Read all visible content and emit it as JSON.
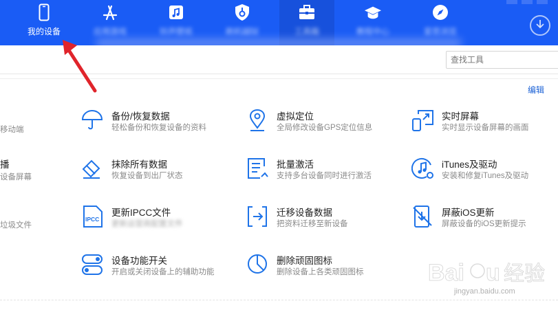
{
  "nav": {
    "items": [
      {
        "label": "我的设备",
        "icon": "phone-icon"
      },
      {
        "label": "应用游戏",
        "icon": "app-store-icon"
      },
      {
        "label": "铃声壁纸",
        "icon": "music-icon"
      },
      {
        "label": "刷机越狱",
        "icon": "shield-icon"
      },
      {
        "label": "工具箱",
        "icon": "toolbox-icon"
      },
      {
        "label": "教程中心",
        "icon": "graduation-cap-icon"
      },
      {
        "label": "爱思浏览",
        "icon": "compass-icon"
      }
    ],
    "accent": "#1a5cf5"
  },
  "search": {
    "placeholder": "查找工具"
  },
  "edit_label": "编辑",
  "left_fragments": [
    "移动端",
    "播",
    "设备屏幕",
    "垃圾文件"
  ],
  "tools": [
    {
      "title": "备份/恢复数据",
      "desc": "轻松备份和恢复设备的资料",
      "icon": "umbrella-icon"
    },
    {
      "title": "虚拟定位",
      "desc": "全局修改设备GPS定位信息",
      "icon": "location-pin-icon"
    },
    {
      "title": "实时屏幕",
      "desc": "实时显示设备屏幕的画面",
      "icon": "screen-mirror-icon"
    },
    {
      "title": "抹除所有数据",
      "desc": "恢复设备到出厂状态",
      "icon": "eraser-icon"
    },
    {
      "title": "批量激活",
      "desc": "支持多台设备同时进行激活",
      "icon": "batch-activate-icon"
    },
    {
      "title": "iTunes及驱动",
      "desc": "安装和修复iTunes及驱动",
      "icon": "itunes-icon"
    },
    {
      "title": "更新IPCC文件",
      "desc": "更新运营商配置文件",
      "icon": "ipcc-file-icon"
    },
    {
      "title": "迁移设备数据",
      "desc": "把资料迁移至新设备",
      "icon": "migrate-icon"
    },
    {
      "title": "屏蔽iOS更新",
      "desc": "屏蔽设备的iOS更新提示",
      "icon": "block-update-icon"
    },
    {
      "title": "设备功能开关",
      "desc": "开启或关闭设备上的辅助功能",
      "icon": "toggle-icon"
    },
    {
      "title": "删除顽固图标",
      "desc": "删除设备上各类顽固图标",
      "icon": "pie-chart-icon"
    }
  ],
  "watermark": {
    "text": "jingyan.baidu.com",
    "brand": "Baidu经验"
  }
}
